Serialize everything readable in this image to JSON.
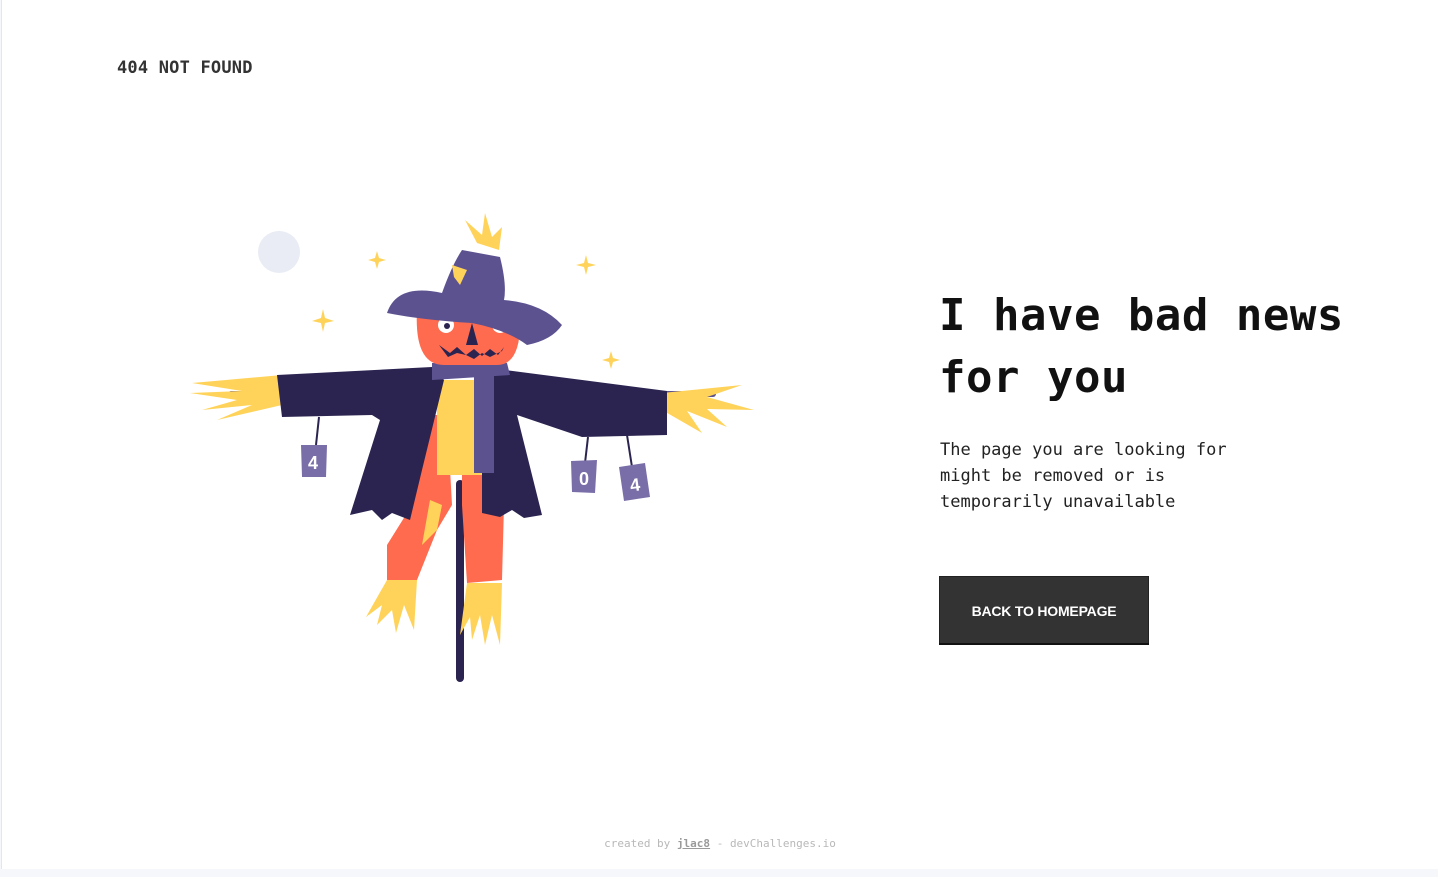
{
  "brand": {
    "label": "404 NOT FOUND"
  },
  "main": {
    "headline": "I have bad news for you",
    "description": "The page you are looking for might be removed or is temporarily unavailable",
    "cta_label": "Back to homepage"
  },
  "illustration": {
    "can_left": "4",
    "can_middle": "0",
    "can_right": "4"
  },
  "footer": {
    "prefix": "created by",
    "author": "jlac8",
    "separator": "-",
    "site": "devChallenges.io"
  },
  "colors": {
    "hat": "#5d5290",
    "coat": "#2b2450",
    "head": "#ff6b4f",
    "straw": "#ffd35a",
    "moon": "#e9ecf5",
    "can": "#7a6ea8",
    "button": "#333333"
  }
}
